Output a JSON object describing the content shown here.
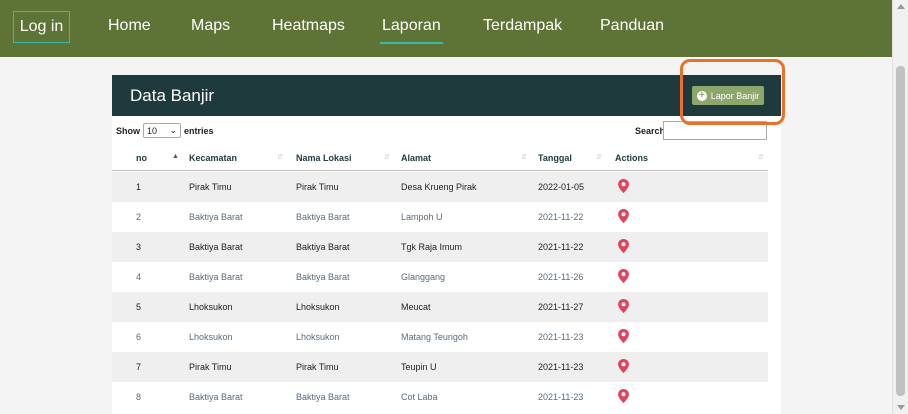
{
  "nav": {
    "login": "Log in",
    "items": [
      "Home",
      "Maps",
      "Heatmaps",
      "Laporan",
      "Terdampak",
      "Panduan"
    ],
    "active": "Laporan"
  },
  "card": {
    "title": "Data Banjir",
    "add_button": "Lapor Banjir"
  },
  "controls": {
    "show_label": "Show",
    "entries_value": "10",
    "entries_label": "entries",
    "search_label": "Search:",
    "search_value": ""
  },
  "table": {
    "columns": [
      "no",
      "Kecamatan",
      "Nama Lokasi",
      "Alamat",
      "Tanggal",
      "Actions"
    ],
    "rows": [
      {
        "no": "1",
        "kecamatan": "Pirak Timu",
        "lokasi": "Pirak Timu",
        "alamat": "Desa Krueng Pirak",
        "tanggal": "2022-01-05",
        "action": "map-pin-icon"
      },
      {
        "no": "2",
        "kecamatan": "Baktiya Barat",
        "lokasi": "Baktiya Barat",
        "alamat": "Lampoh U",
        "tanggal": "2021-11-22",
        "action": "map-pin-icon"
      },
      {
        "no": "3",
        "kecamatan": "Baktiya Barat",
        "lokasi": "Baktiya Barat",
        "alamat": "Tgk Raja Imum",
        "tanggal": "2021-11-22",
        "action": "map-pin-icon"
      },
      {
        "no": "4",
        "kecamatan": "Baktiya Barat",
        "lokasi": "Baktiya Barat",
        "alamat": "Glanggang",
        "tanggal": "2021-11-26",
        "action": "map-pin-icon"
      },
      {
        "no": "5",
        "kecamatan": "Lhoksukon",
        "lokasi": "Lhoksukon",
        "alamat": "Meucat",
        "tanggal": "2021-11-27",
        "action": "map-pin-icon"
      },
      {
        "no": "6",
        "kecamatan": "Lhoksukon",
        "lokasi": "Lhoksukon",
        "alamat": "Matang Teungoh",
        "tanggal": "2021-11-23",
        "action": "map-pin-icon"
      },
      {
        "no": "7",
        "kecamatan": "Pirak Timu",
        "lokasi": "Pirak Timu",
        "alamat": "Teupin U",
        "tanggal": "2021-11-23",
        "action": "map-pin-icon"
      },
      {
        "no": "8",
        "kecamatan": "Baktiya Barat",
        "lokasi": "Baktiya Barat",
        "alamat": "Cot Laba",
        "tanggal": "2021-11-23",
        "action": "map-pin-icon"
      }
    ]
  },
  "colors": {
    "navbar": "#5d7436",
    "card_header": "#1f3a3d",
    "add_button": "#8da66b",
    "highlight": "#e8722c",
    "pin": "#e0445a"
  }
}
